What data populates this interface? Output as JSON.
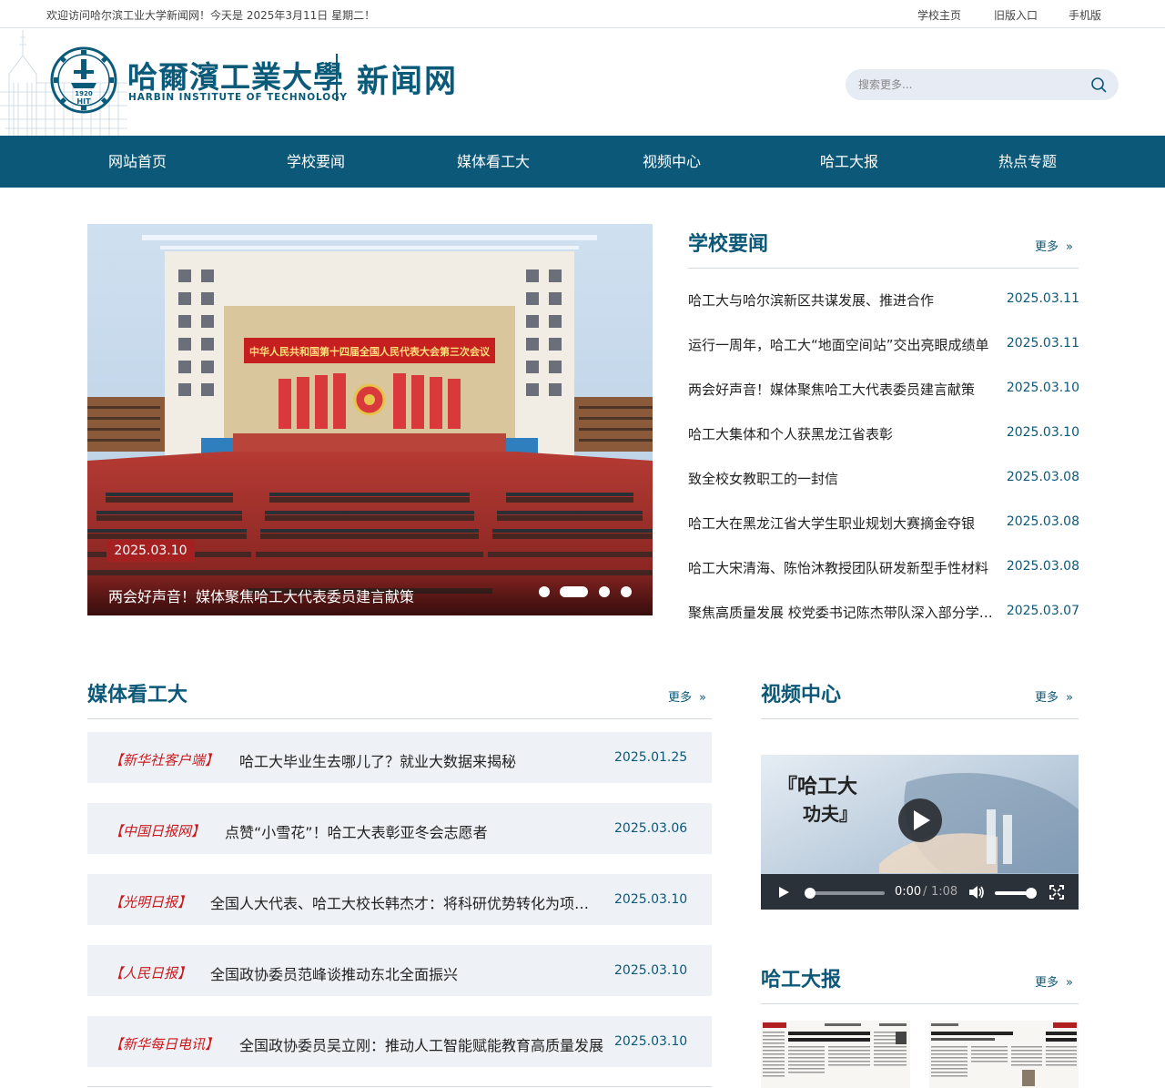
{
  "topbar": {
    "welcome": "欢迎访问哈尔滨工业大学新闻网！今天是 2025年3月11日 星期二！",
    "links": [
      "学校主页",
      "旧版入口",
      "手机版"
    ]
  },
  "header": {
    "logo_cn": "哈爾濱工業大學",
    "logo_en": "HARBIN INSTITUTE OF TECHNOLOGY",
    "site_name": "新闻网",
    "emblem_year": "1920",
    "emblem_abbr": "HIT",
    "search_placeholder": "搜索更多..."
  },
  "nav": [
    "网站首页",
    "学校要闻",
    "媒体看工大",
    "视频中心",
    "哈工大报",
    "热点专题"
  ],
  "carousel": {
    "banner_text": "中华人民共和国第十四届全国人民代表大会第三次会议",
    "date": "2025.03.10",
    "caption": "两会好声音！媒体聚焦哈工大代表委员建言献策",
    "slide_count": 4,
    "active_index": 1
  },
  "school_news": {
    "title": "学校要闻",
    "more": "更多",
    "items": [
      {
        "title": "哈工大与哈尔滨新区共谋发展、推进合作",
        "date": "2025.03.11"
      },
      {
        "title": "运行一周年，哈工大“地面空间站”交出亮眼成绩单",
        "date": "2025.03.11"
      },
      {
        "title": "两会好声音！媒体聚焦哈工大代表委员建言献策",
        "date": "2025.03.10"
      },
      {
        "title": "哈工大集体和个人获黑龙江省表彰",
        "date": "2025.03.10"
      },
      {
        "title": "致全校女教职工的一封信",
        "date": "2025.03.08"
      },
      {
        "title": "哈工大在黑龙江省大学生职业规划大赛摘金夺银",
        "date": "2025.03.08"
      },
      {
        "title": "哈工大宋清海、陈怡沐教授团队研发新型手性材料",
        "date": "2025.03.08"
      },
      {
        "title": "聚焦高质量发展 校党委书记陈杰带队深入部分学院调研",
        "date": "2025.03.07"
      }
    ]
  },
  "media": {
    "title": "媒体看工大",
    "more": "更多",
    "items": [
      {
        "source": "【新华社客户端】",
        "title": "哈工大毕业生去哪儿了？就业大数据来揭秘",
        "date": "2025.01.25"
      },
      {
        "source": "【中国日报网】",
        "title": "点赞“小雪花”！哈工大表彰亚冬会志愿者",
        "date": "2025.03.06"
      },
      {
        "source": "【光明日报】",
        "title": "全国人大代表、哈工大校长韩杰才：将科研优势转化为项目优势",
        "date": "2025.03.10"
      },
      {
        "source": "【人民日报】",
        "title": "全国政协委员范峰谈推动东北全面振兴",
        "date": "2025.03.10"
      },
      {
        "source": "【新华每日电讯】",
        "title": "全国政协委员吴立刚：推动人工智能赋能教育高质量发展",
        "date": "2025.03.10"
      }
    ]
  },
  "video": {
    "title": "视频中心",
    "more": "更多",
    "overlay_text_1": "『哈工大",
    "overlay_text_2": "功夫』",
    "current_time": "0:00",
    "separator": "/",
    "duration": "1:08",
    "progress": 0,
    "volume": 1.0
  },
  "newspaper": {
    "title": "哈工大报",
    "more": "更多"
  },
  "colors": {
    "brand": "#0c5878",
    "accent_red": "#c8191d",
    "badge_red": "#a52021",
    "row_bg": "#eef2f6"
  }
}
